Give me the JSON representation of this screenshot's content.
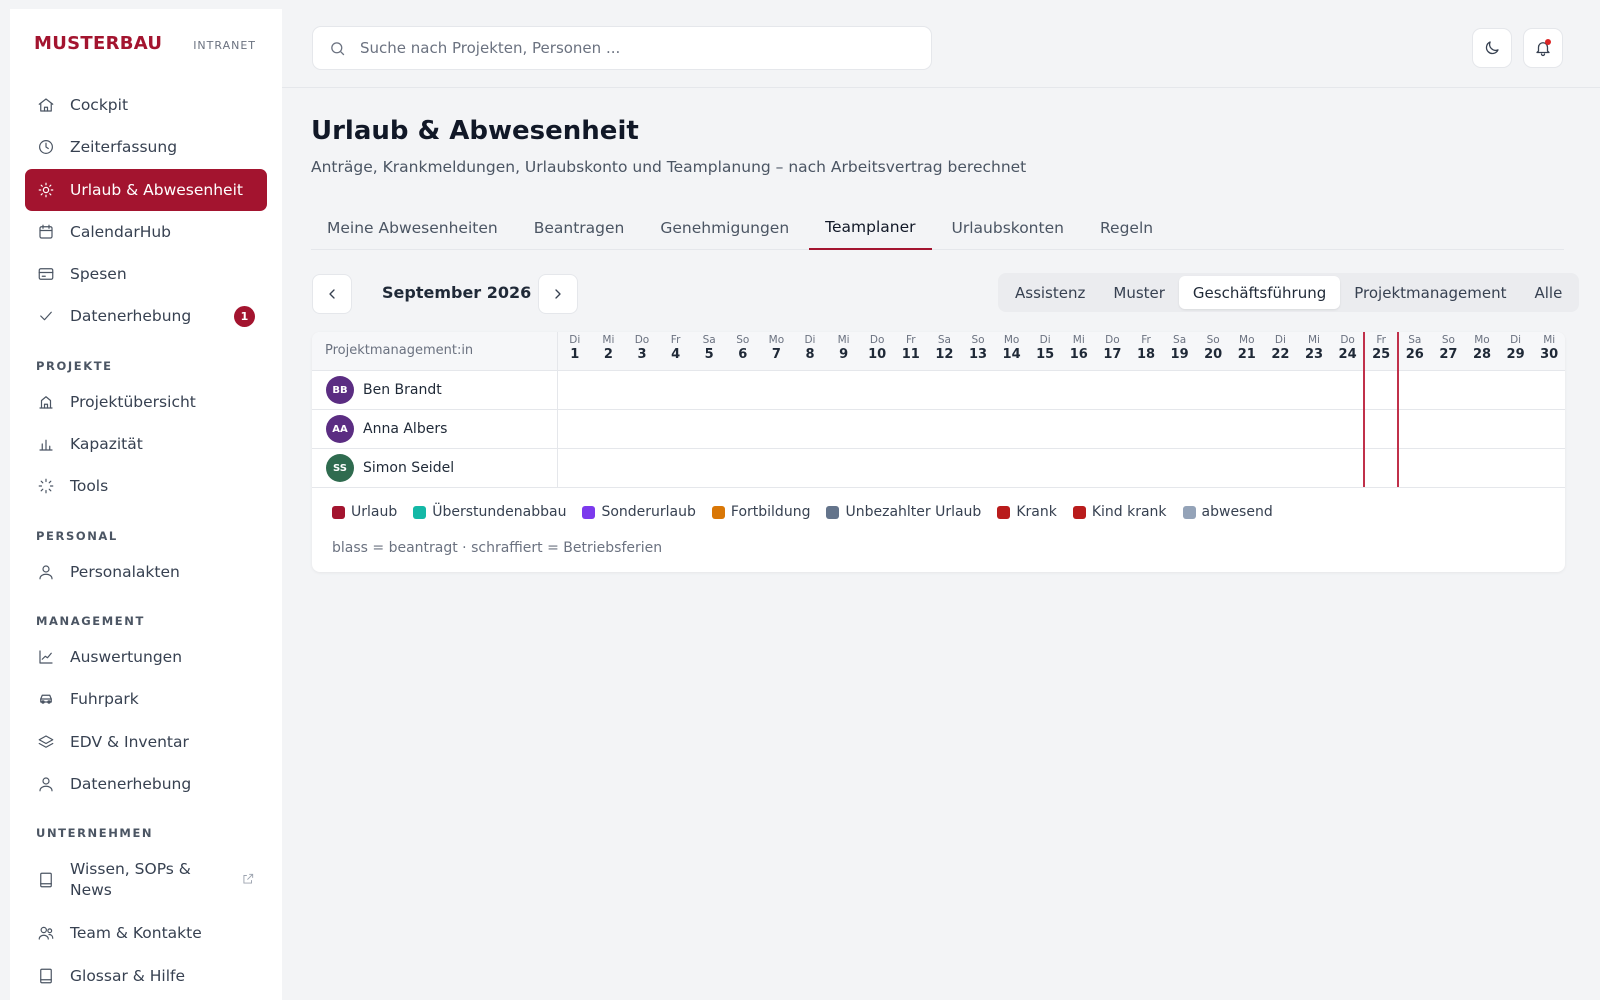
{
  "brand": {
    "name": "MUSTERBAU",
    "sub": "INTRANET"
  },
  "nav": {
    "main": [
      {
        "label": "Cockpit",
        "icon": "home-icon"
      },
      {
        "label": "Zeiterfassung",
        "icon": "clock-icon"
      },
      {
        "label": "Urlaub & Abwesenheit",
        "icon": "sun-icon",
        "active": true
      },
      {
        "label": "CalendarHub",
        "icon": "calendar-icon"
      },
      {
        "label": "Spesen",
        "icon": "credit-card-icon"
      },
      {
        "label": "Datenerhebung",
        "icon": "check-icon",
        "badge": "1"
      }
    ],
    "sections": [
      {
        "title": "PROJEKTE",
        "items": [
          {
            "label": "Projektübersicht",
            "icon": "building-icon"
          },
          {
            "label": "Kapazität",
            "icon": "bar-chart-icon"
          },
          {
            "label": "Tools",
            "icon": "loader-icon"
          }
        ]
      },
      {
        "title": "PERSONAL",
        "items": [
          {
            "label": "Personalakten",
            "icon": "user-icon"
          }
        ]
      },
      {
        "title": "MANAGEMENT",
        "items": [
          {
            "label": "Auswertungen",
            "icon": "line-chart-icon"
          },
          {
            "label": "Fuhrpark",
            "icon": "car-icon"
          },
          {
            "label": "EDV & Inventar",
            "icon": "layers-icon"
          },
          {
            "label": "Datenerhebung",
            "icon": "user-icon"
          }
        ]
      },
      {
        "title": "UNTERNEHMEN",
        "items": [
          {
            "label": "Wissen, SOPs & News",
            "icon": "book-icon",
            "external": true
          },
          {
            "label": "Team & Kontakte",
            "icon": "users-icon"
          },
          {
            "label": "Glossar & Hilfe",
            "icon": "book-icon"
          }
        ]
      }
    ]
  },
  "search": {
    "placeholder": "Suche nach Projekten, Personen ..."
  },
  "page": {
    "title": "Urlaub & Abwesenheit",
    "subtitle": "Anträge, Krankmeldungen, Urlaubskonto und Teamplanung – nach Arbeitsvertrag berechnet"
  },
  "tabs": [
    "Meine Abwesenheiten",
    "Beantragen",
    "Genehmigungen",
    "Teamplaner",
    "Urlaubskonten",
    "Regeln"
  ],
  "active_tab": "Teamplaner",
  "planner": {
    "month": "September 2026",
    "filters": [
      "Assistenz",
      "Muster",
      "Geschäftsführung",
      "Projektmanagement",
      "Alle"
    ],
    "active_filter": "Geschäftsführung",
    "name_column_header": "Projektmanagement:in",
    "days": [
      {
        "dow": "Di",
        "num": "1"
      },
      {
        "dow": "Mi",
        "num": "2"
      },
      {
        "dow": "Do",
        "num": "3"
      },
      {
        "dow": "Fr",
        "num": "4"
      },
      {
        "dow": "Sa",
        "num": "5"
      },
      {
        "dow": "So",
        "num": "6"
      },
      {
        "dow": "Mo",
        "num": "7"
      },
      {
        "dow": "Di",
        "num": "8"
      },
      {
        "dow": "Mi",
        "num": "9"
      },
      {
        "dow": "Do",
        "num": "10"
      },
      {
        "dow": "Fr",
        "num": "11"
      },
      {
        "dow": "Sa",
        "num": "12"
      },
      {
        "dow": "So",
        "num": "13"
      },
      {
        "dow": "Mo",
        "num": "14"
      },
      {
        "dow": "Di",
        "num": "15"
      },
      {
        "dow": "Mi",
        "num": "16"
      },
      {
        "dow": "Do",
        "num": "17"
      },
      {
        "dow": "Fr",
        "num": "18"
      },
      {
        "dow": "Sa",
        "num": "19"
      },
      {
        "dow": "So",
        "num": "20"
      },
      {
        "dow": "Mo",
        "num": "21"
      },
      {
        "dow": "Di",
        "num": "22"
      },
      {
        "dow": "Mi",
        "num": "23"
      },
      {
        "dow": "Do",
        "num": "24"
      },
      {
        "dow": "Fr",
        "num": "25"
      },
      {
        "dow": "Sa",
        "num": "26"
      },
      {
        "dow": "So",
        "num": "27"
      },
      {
        "dow": "Mo",
        "num": "28"
      },
      {
        "dow": "Di",
        "num": "29"
      },
      {
        "dow": "Mi",
        "num": "30"
      }
    ],
    "today": "25",
    "people": [
      {
        "initials": "BB",
        "name": "Ben Brandt",
        "color": "#5b2d82"
      },
      {
        "initials": "AA",
        "name": "Anna Albers",
        "color": "#5b2d82"
      },
      {
        "initials": "SS",
        "name": "Simon Seidel",
        "color": "#2f6b4f"
      }
    ],
    "legend": [
      {
        "label": "Urlaub",
        "color": "#a3142f"
      },
      {
        "label": "Überstundenabbau",
        "color": "#14b8a6"
      },
      {
        "label": "Sonderurlaub",
        "color": "#7c3aed"
      },
      {
        "label": "Fortbildung",
        "color": "#d97706"
      },
      {
        "label": "Unbezahlter Urlaub",
        "color": "#64748b"
      },
      {
        "label": "Krank",
        "color": "#b91c1c"
      },
      {
        "label": "Kind krank",
        "color": "#b91c1c"
      },
      {
        "label": "abwesend",
        "color": "#94a3b8"
      }
    ],
    "legend_note": "blass = beantragt · schraffiert = Betriebsferien"
  }
}
